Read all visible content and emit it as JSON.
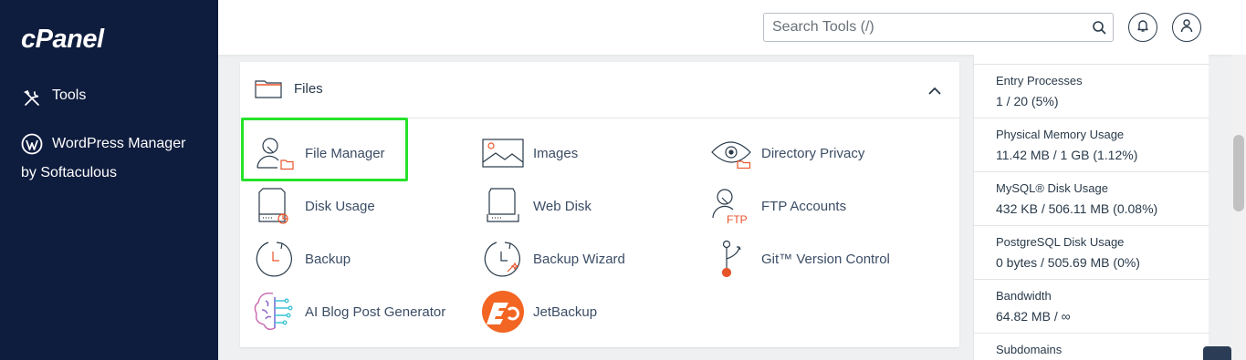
{
  "sidebar": {
    "logo": "cPanel",
    "items": [
      {
        "label": "Tools",
        "icon": "tools-icon"
      },
      {
        "label_line1": "WordPress Manager",
        "label_line2": "by Softaculous",
        "icon": "wordpress-icon"
      }
    ]
  },
  "header": {
    "search_placeholder": "Search Tools (/)",
    "icons": [
      "bell-icon",
      "user-icon"
    ]
  },
  "files_panel": {
    "title": "Files",
    "tools": [
      {
        "label": "File Manager",
        "icon": "file-manager-icon",
        "highlighted": true
      },
      {
        "label": "Images",
        "icon": "images-icon"
      },
      {
        "label": "Directory Privacy",
        "icon": "directory-privacy-icon"
      },
      {
        "label": "Disk Usage",
        "icon": "disk-usage-icon"
      },
      {
        "label": "Web Disk",
        "icon": "web-disk-icon"
      },
      {
        "label": "FTP Accounts",
        "icon": "ftp-accounts-icon"
      },
      {
        "label": "Backup",
        "icon": "backup-icon"
      },
      {
        "label": "Backup Wizard",
        "icon": "backup-wizard-icon"
      },
      {
        "label": "Git™ Version Control",
        "icon": "git-icon"
      },
      {
        "label": "AI Blog Post Generator",
        "icon": "ai-blog-icon"
      },
      {
        "label": "JetBackup",
        "icon": "jetbackup-icon"
      }
    ]
  },
  "stats": [
    {
      "label": "Entry Processes",
      "value": "1 / 20   (5%)"
    },
    {
      "label": "Physical Memory Usage",
      "value": "11.42 MB / 1 GB   (1.12%)"
    },
    {
      "label": "MySQL® Disk Usage",
      "value": "432 KB / 506.11 MB   (0.08%)"
    },
    {
      "label": "PostgreSQL Disk Usage",
      "value": "0 bytes / 505.69 MB   (0%)"
    },
    {
      "label": "Bandwidth",
      "value": "64.82 MB / ∞"
    },
    {
      "label": "Subdomains",
      "value": ""
    }
  ],
  "colors": {
    "sidebar_bg": "#0e1c3d",
    "accent_orange": "#e8542a",
    "highlight_green": "#25e22a",
    "text": "#293a4a"
  }
}
